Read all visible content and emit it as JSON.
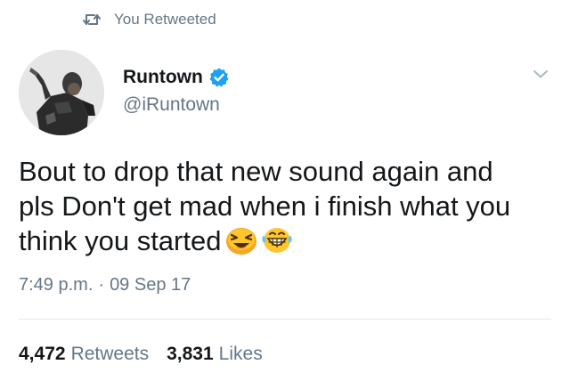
{
  "social_context": {
    "icon": "retweet-icon",
    "label": "You Retweeted"
  },
  "author": {
    "display_name": "Runtown",
    "handle": "@iRuntown",
    "verified": true,
    "verified_icon": "verified-badge-icon",
    "avatar": "profile-avatar"
  },
  "menu": {
    "icon": "chevron-down-icon"
  },
  "tweet": {
    "line1": "Bout to drop that new sound again and",
    "line2": "pls Don't get mad when i finish what you",
    "line3": "think you started",
    "emojis": [
      "laughing-squint-emoji",
      "grinning-tears-emoji"
    ]
  },
  "meta": {
    "time": "7:49 p.m.",
    "separator": "·",
    "date": "09 Sep 17"
  },
  "stats": {
    "retweets_count": "4,472",
    "retweets_label": "Retweets",
    "likes_count": "3,831",
    "likes_label": "Likes"
  },
  "colors": {
    "text_primary": "#14171a",
    "text_secondary": "#657786",
    "verified_blue": "#1da1f2",
    "divider": "#e1e8ed"
  }
}
